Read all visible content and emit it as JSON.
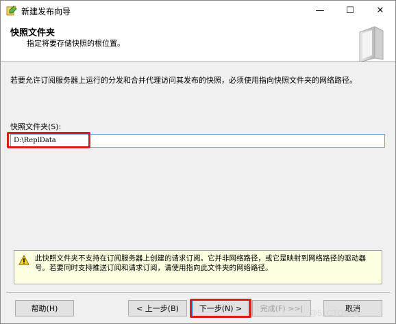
{
  "window": {
    "title": "新建发布向导",
    "controls": {
      "minimize": "—",
      "maximize": "☐",
      "close": "✕"
    }
  },
  "header": {
    "title": "快照文件夹",
    "subtitle": "指定将要存储快照的根位置。"
  },
  "main": {
    "description": "若要允许订阅服务器上运行的分发和合并代理访问其发布的快照，必须使用指向快照文件夹的网络路径。",
    "folder_label": "快照文件夹(S):",
    "folder_value": "D:\\ReplData"
  },
  "warning": {
    "icon": "warning-icon",
    "text": "此快照文件夹不支持在订阅服务器上创建的请求订阅。它并非网络路径，或它是映射到网络路径的驱动器号。若要同时支持推送订阅和请求订阅，请使用指向此文件夹的网络路径。"
  },
  "buttons": {
    "help": "帮助(H)",
    "back": "< 上一步(B)",
    "next": "下一步(N) >",
    "finish": "完成(F) >>|",
    "cancel": "取消"
  },
  "watermark": "@51CTO博客",
  "colors": {
    "highlight": "#d21f1f",
    "warning_bg": "#ffffe1",
    "input_border": "#7a9cd3"
  }
}
